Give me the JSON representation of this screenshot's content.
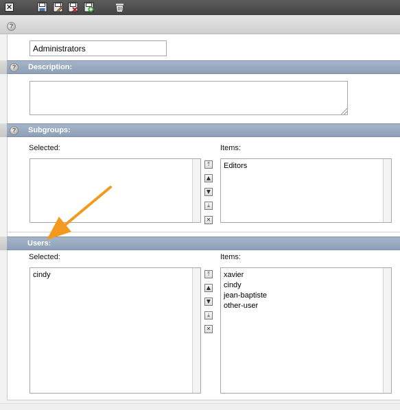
{
  "toolbar": {
    "close_glyph": "✕",
    "icons": [
      "save-icon",
      "save-as-icon",
      "save-close-icon",
      "save-new-icon",
      "trash-icon"
    ]
  },
  "group": {
    "name_value": "Administrators"
  },
  "description": {
    "title": "Description:",
    "value": ""
  },
  "subgroups": {
    "title": "Subgroups:",
    "selected_label": "Selected:",
    "items_label": "Items:",
    "selected_items": [],
    "available_items": [
      "Editors"
    ]
  },
  "users": {
    "title": "Users:",
    "selected_label": "Selected:",
    "items_label": "Items:",
    "selected_items": [
      "cindy"
    ],
    "available_items": [
      "xavier",
      "cindy",
      "jean-baptiste",
      "other-user"
    ]
  },
  "order_controls": {
    "move_top": "⤒",
    "move_up": "▲",
    "move_down": "▼",
    "move_bottom": "⤓",
    "remove": "✕"
  },
  "help_glyph": "?",
  "colors": {
    "section_bar": "#97a8bd",
    "arrow": "#f39a1e",
    "toolbar": "#505050"
  }
}
